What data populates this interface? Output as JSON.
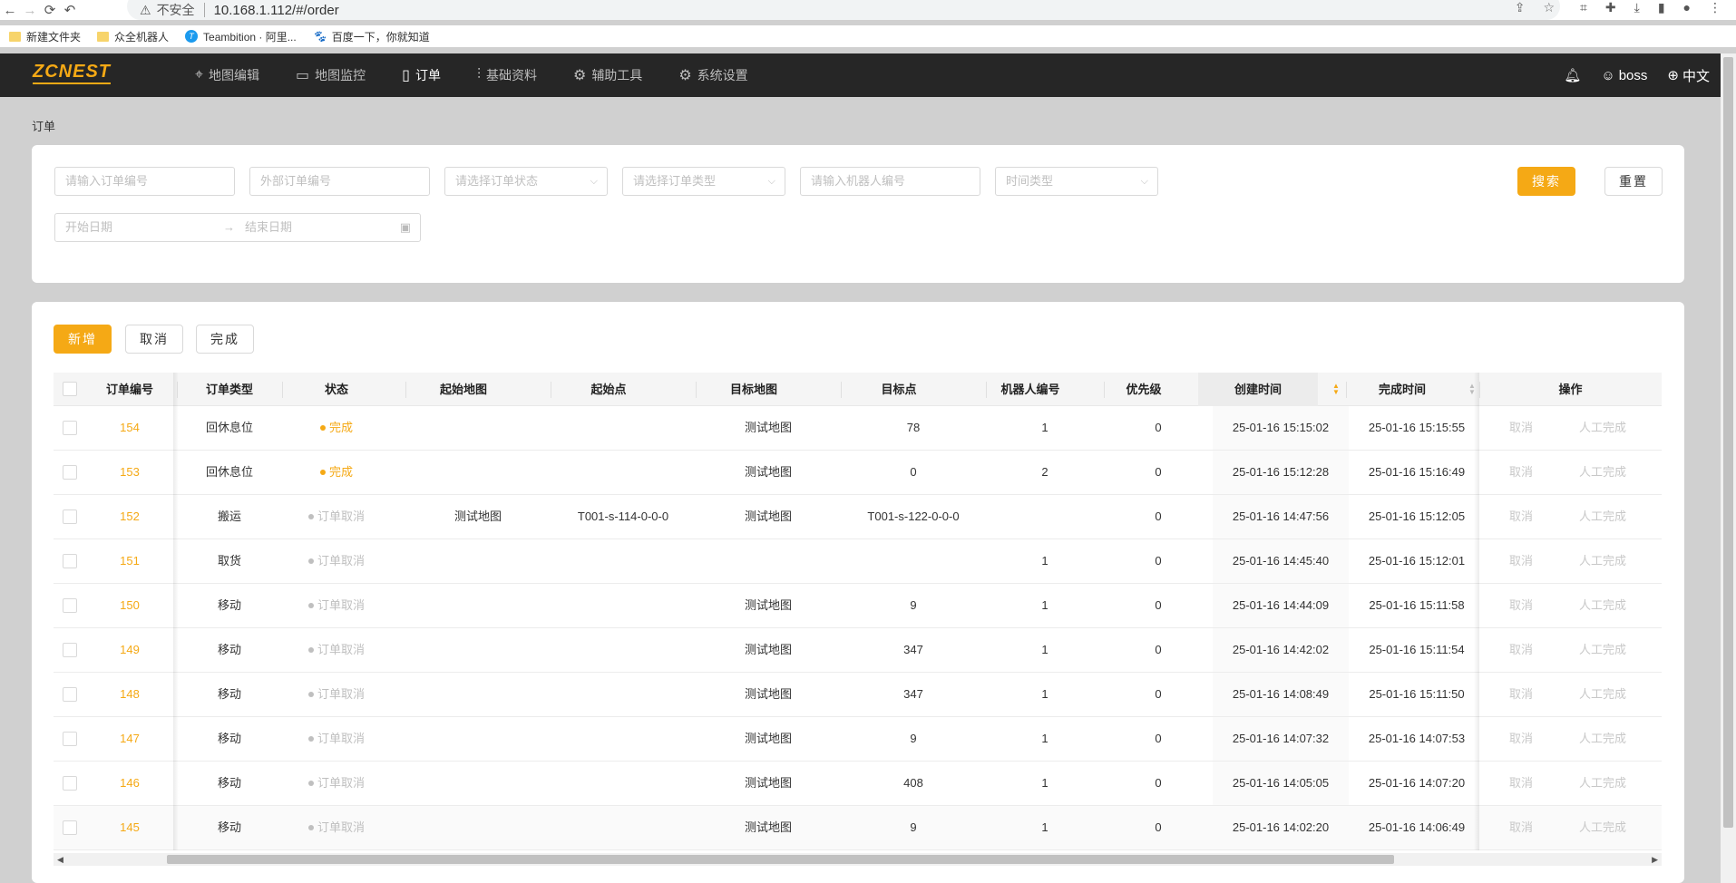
{
  "browser": {
    "insecure": "不安全",
    "url": "10.168.1.112/#/order",
    "bookmarks": [
      {
        "label": "新建文件夹",
        "icon": "folder-icon"
      },
      {
        "label": "众全机器人",
        "icon": "folder-icon"
      },
      {
        "label": "Teambition · 阿里...",
        "icon": "teambition-icon"
      },
      {
        "label": "百度一下，你就知道",
        "icon": "baidu-paw-icon"
      }
    ]
  },
  "app": {
    "logo": "ZCNEST",
    "menu": [
      {
        "label": "地图编辑",
        "icon": "map-pin-icon"
      },
      {
        "label": "地图监控",
        "icon": "chart-icon"
      },
      {
        "label": "订单",
        "icon": "document-icon",
        "active": true
      },
      {
        "label": "基础资料",
        "icon": "sliders-icon"
      },
      {
        "label": "辅助工具",
        "icon": "gear-icon"
      },
      {
        "label": "系统设置",
        "icon": "gear-icon"
      }
    ],
    "user": "boss",
    "language": "中文",
    "accent": "#f5a915"
  },
  "page": {
    "title": "订单"
  },
  "search": {
    "order_no_placeholder": "请输入订单编号",
    "external_no_placeholder": "外部订单编号",
    "status_placeholder": "请选择订单状态",
    "type_placeholder": "请选择订单类型",
    "robot_placeholder": "请输入机器人编号",
    "time_type_placeholder": "时间类型",
    "start_date_placeholder": "开始日期",
    "end_date_placeholder": "结束日期",
    "search_label": "搜索",
    "reset_label": "重置"
  },
  "toolbar": {
    "add_label": "新增",
    "cancel_label": "取消",
    "complete_label": "完成"
  },
  "table": {
    "columns": [
      "订单编号",
      "订单类型",
      "状态",
      "起始地图",
      "起始点",
      "目标地图",
      "目标点",
      "机器人编号",
      "优先级",
      "创建时间",
      "完成时间",
      "操作"
    ],
    "action_cancel": "取消",
    "action_manual": "人工完成",
    "rows": [
      {
        "id": "154",
        "type": "回休息位",
        "status": "完成",
        "status_kind": "done",
        "start_map": "",
        "start_point": "",
        "target_map": "测试地图",
        "target_point": "78",
        "robot": "1",
        "priority": "0",
        "created": "25-01-16 15:15:02",
        "finished": "25-01-16 15:15:55"
      },
      {
        "id": "153",
        "type": "回休息位",
        "status": "完成",
        "status_kind": "done",
        "start_map": "",
        "start_point": "",
        "target_map": "测试地图",
        "target_point": "0",
        "robot": "2",
        "priority": "0",
        "created": "25-01-16 15:12:28",
        "finished": "25-01-16 15:16:49"
      },
      {
        "id": "152",
        "type": "搬运",
        "status": "订单取消",
        "status_kind": "cancel",
        "start_map": "测试地图",
        "start_point": "T001-s-114-0-0-0",
        "target_map": "测试地图",
        "target_point": "T001-s-122-0-0-0",
        "robot": "",
        "priority": "0",
        "created": "25-01-16 14:47:56",
        "finished": "25-01-16 15:12:05"
      },
      {
        "id": "151",
        "type": "取货",
        "status": "订单取消",
        "status_kind": "cancel",
        "start_map": "",
        "start_point": "",
        "target_map": "",
        "target_point": "",
        "robot": "1",
        "priority": "0",
        "created": "25-01-16 14:45:40",
        "finished": "25-01-16 15:12:01"
      },
      {
        "id": "150",
        "type": "移动",
        "status": "订单取消",
        "status_kind": "cancel",
        "start_map": "",
        "start_point": "",
        "target_map": "测试地图",
        "target_point": "9",
        "robot": "1",
        "priority": "0",
        "created": "25-01-16 14:44:09",
        "finished": "25-01-16 15:11:58"
      },
      {
        "id": "149",
        "type": "移动",
        "status": "订单取消",
        "status_kind": "cancel",
        "start_map": "",
        "start_point": "",
        "target_map": "测试地图",
        "target_point": "347",
        "robot": "1",
        "priority": "0",
        "created": "25-01-16 14:42:02",
        "finished": "25-01-16 15:11:54"
      },
      {
        "id": "148",
        "type": "移动",
        "status": "订单取消",
        "status_kind": "cancel",
        "start_map": "",
        "start_point": "",
        "target_map": "测试地图",
        "target_point": "347",
        "robot": "1",
        "priority": "0",
        "created": "25-01-16 14:08:49",
        "finished": "25-01-16 15:11:50"
      },
      {
        "id": "147",
        "type": "移动",
        "status": "订单取消",
        "status_kind": "cancel",
        "start_map": "",
        "start_point": "",
        "target_map": "测试地图",
        "target_point": "9",
        "robot": "1",
        "priority": "0",
        "created": "25-01-16 14:07:32",
        "finished": "25-01-16 14:07:53"
      },
      {
        "id": "146",
        "type": "移动",
        "status": "订单取消",
        "status_kind": "cancel",
        "start_map": "",
        "start_point": "",
        "target_map": "测试地图",
        "target_point": "408",
        "robot": "1",
        "priority": "0",
        "created": "25-01-16 14:05:05",
        "finished": "25-01-16 14:07:20"
      },
      {
        "id": "145",
        "type": "移动",
        "status": "订单取消",
        "status_kind": "cancel",
        "start_map": "",
        "start_point": "",
        "target_map": "测试地图",
        "target_point": "9",
        "robot": "1",
        "priority": "0",
        "created": "25-01-16 14:02:20",
        "finished": "25-01-16 14:06:49"
      }
    ]
  }
}
